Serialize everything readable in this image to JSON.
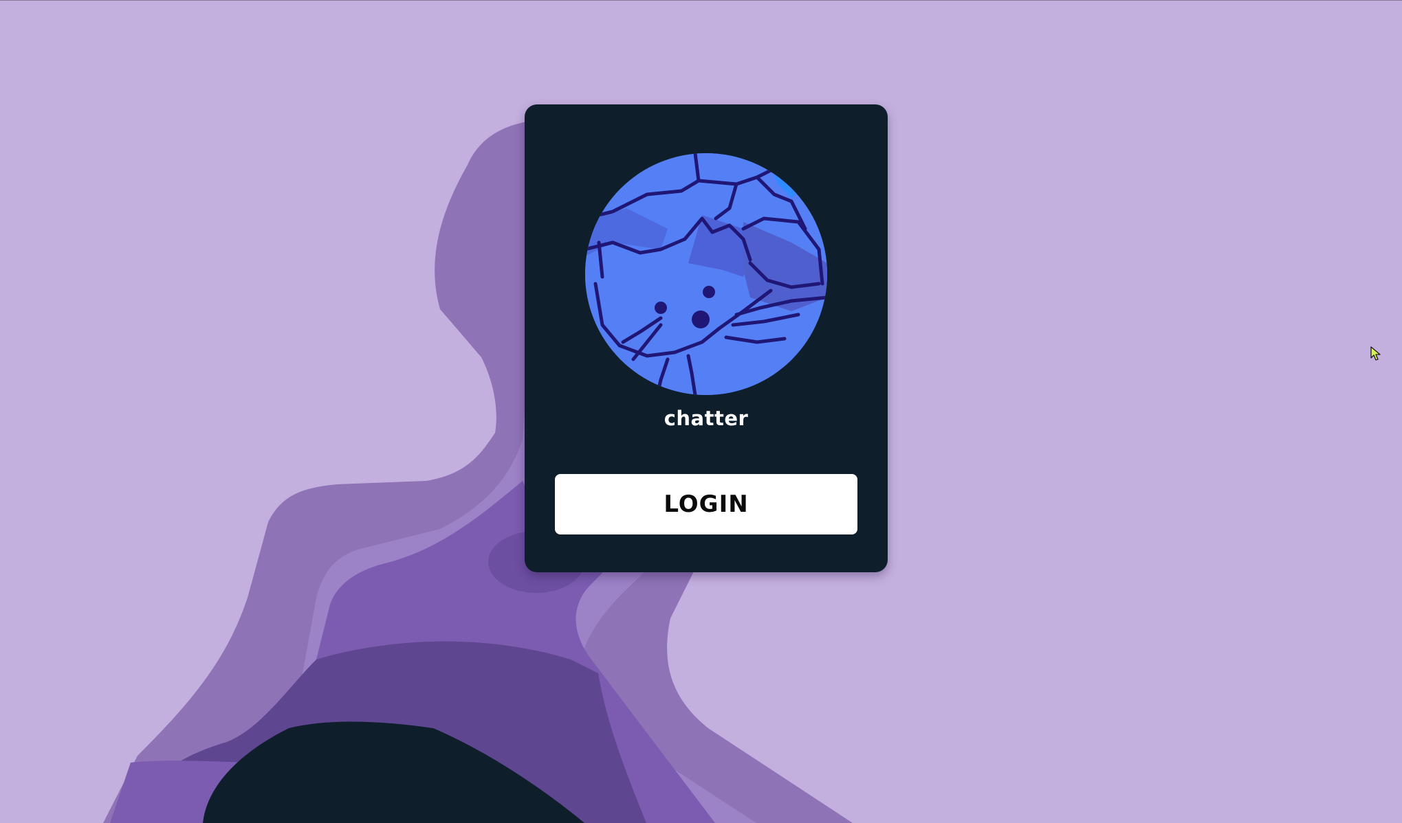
{
  "app": {
    "name": "chatter"
  },
  "login": {
    "button_label": "LOGIN"
  },
  "colors": {
    "background": "#c4b0df",
    "card": "#0f1e2b",
    "avatar_blue": "#5580f5",
    "avatar_lines": "#1f1675",
    "button_bg": "#ffffff",
    "button_text": "#0b0b0b"
  },
  "icons": {
    "avatar": "cat-avatar-icon",
    "cursor": "mouse-pointer-icon"
  }
}
